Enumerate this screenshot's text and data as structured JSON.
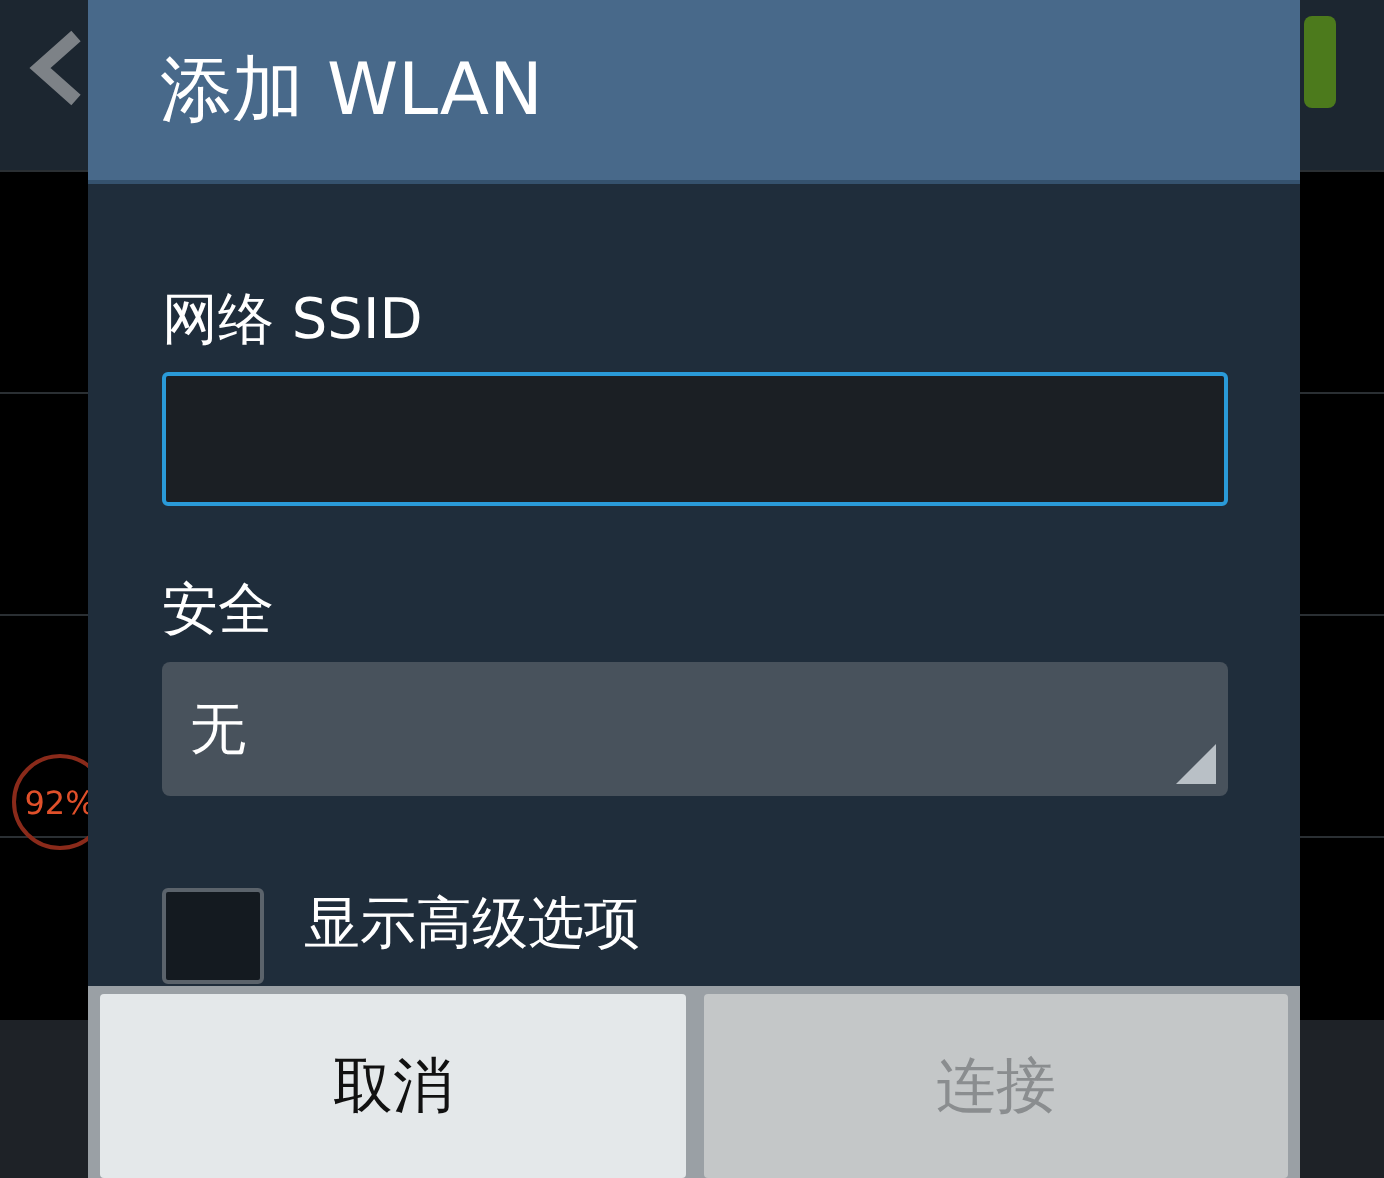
{
  "background": {
    "memory_widget": {
      "text": "92%"
    }
  },
  "dialog": {
    "title": "添加 WLAN",
    "ssid": {
      "label": "网络 SSID"
    },
    "security": {
      "label": "安全",
      "value": "无"
    },
    "advanced": {
      "label": "显示高级选项",
      "checked": false
    },
    "buttons": [
      {
        "label": "取消",
        "disabled": false
      },
      {
        "label": "连接",
        "disabled": true
      }
    ]
  }
}
